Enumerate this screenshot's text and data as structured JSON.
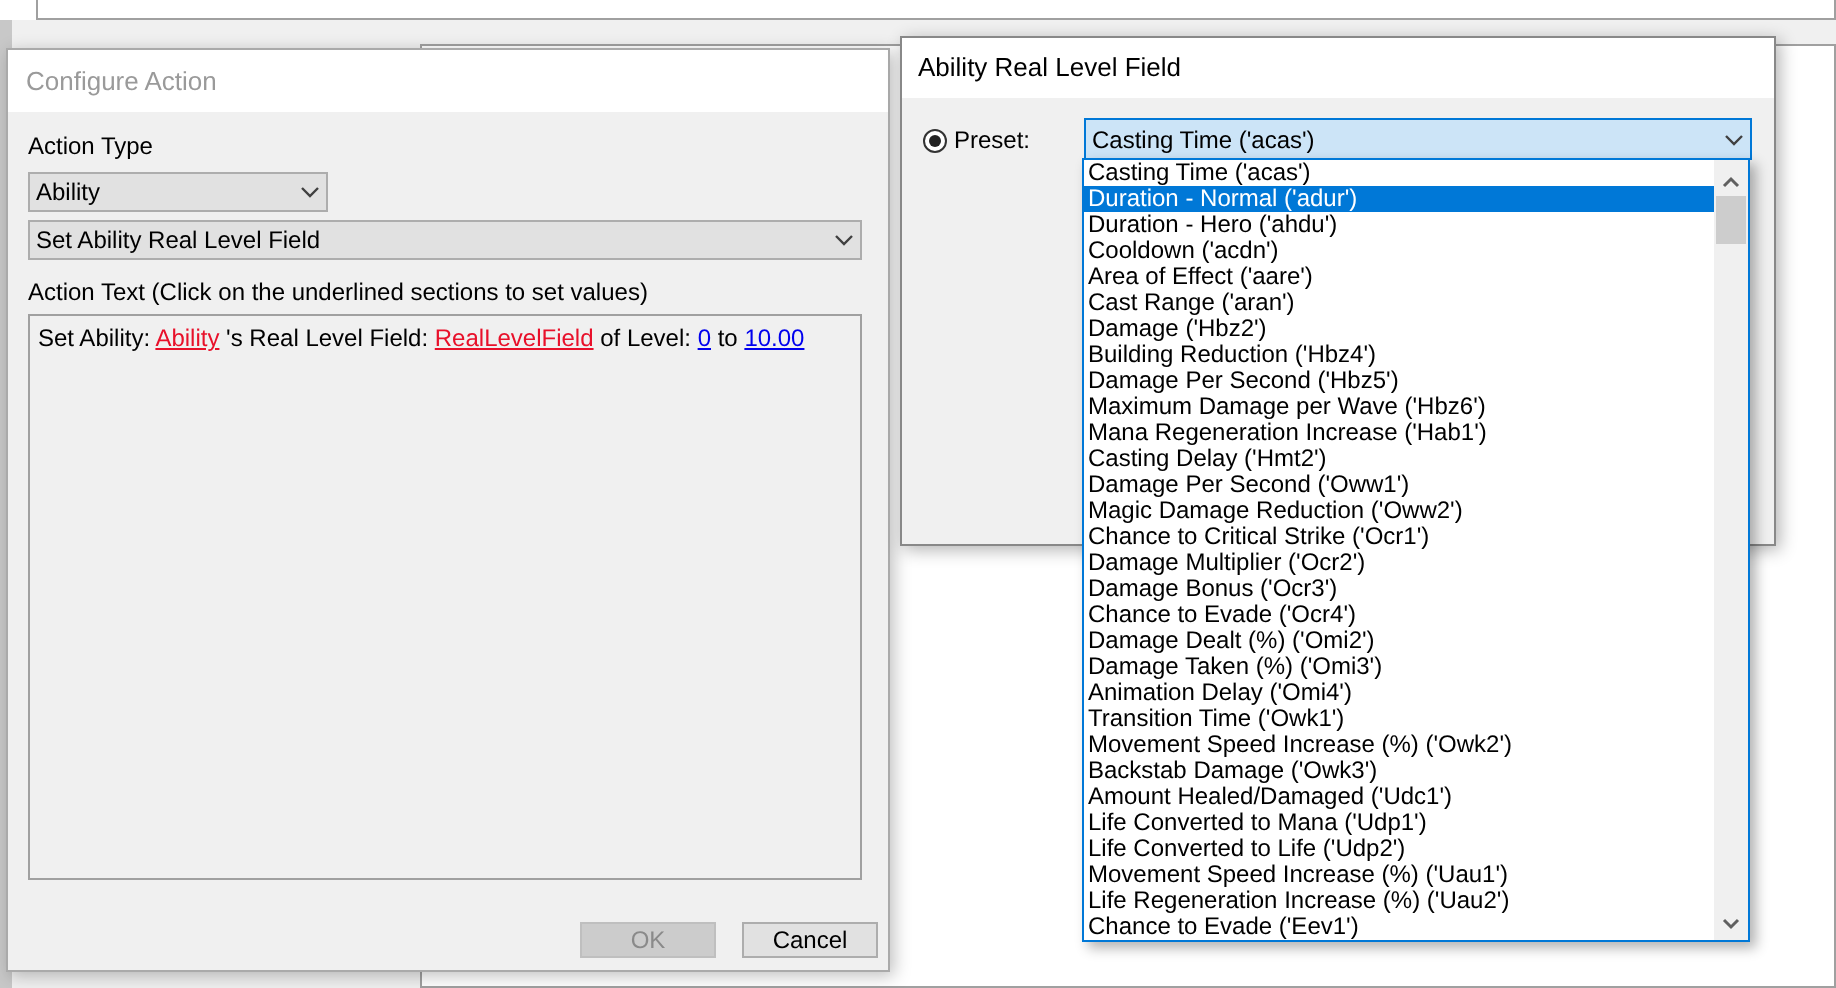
{
  "configure_action": {
    "title": "Configure Action",
    "active": false,
    "action_type_label": "Action Type",
    "category_combo": {
      "value": "Ability"
    },
    "action_combo": {
      "value": "Set Ability Real Level Field"
    },
    "action_text_label": "Action Text (Click on the underlined sections to set values)",
    "action_text": [
      {
        "kind": "plain",
        "text": "Set Ability: "
      },
      {
        "kind": "unset",
        "text": "Ability"
      },
      {
        "kind": "plain",
        "text": " 's Real Level Field: "
      },
      {
        "kind": "unset",
        "text": "RealLevelField"
      },
      {
        "kind": "plain",
        "text": " of Level: "
      },
      {
        "kind": "set",
        "text": "0"
      },
      {
        "kind": "plain",
        "text": " to "
      },
      {
        "kind": "set",
        "text": "10.00"
      }
    ],
    "buttons": [
      {
        "label": "OK",
        "disabled": true
      },
      {
        "label": "Cancel",
        "disabled": false
      }
    ]
  },
  "field_dialog": {
    "title": "Ability Real Level Field",
    "preset_radio": {
      "label": "Preset:",
      "checked": true
    },
    "preset_combo": {
      "value": "Casting Time ('acas')"
    },
    "options": [
      {
        "label": "Casting Time ('acas')",
        "selected": false
      },
      {
        "label": "Duration - Normal ('adur')",
        "selected": true
      },
      {
        "label": "Duration - Hero ('ahdu')",
        "selected": false
      },
      {
        "label": "Cooldown ('acdn')",
        "selected": false
      },
      {
        "label": "Area of Effect ('aare')",
        "selected": false
      },
      {
        "label": "Cast Range ('aran')",
        "selected": false
      },
      {
        "label": "Damage ('Hbz2')",
        "selected": false
      },
      {
        "label": "Building Reduction ('Hbz4')",
        "selected": false
      },
      {
        "label": "Damage Per Second ('Hbz5')",
        "selected": false
      },
      {
        "label": "Maximum Damage per Wave ('Hbz6')",
        "selected": false
      },
      {
        "label": "Mana Regeneration Increase ('Hab1')",
        "selected": false
      },
      {
        "label": "Casting Delay ('Hmt2')",
        "selected": false
      },
      {
        "label": "Damage Per Second ('Oww1')",
        "selected": false
      },
      {
        "label": "Magic Damage Reduction ('Oww2')",
        "selected": false
      },
      {
        "label": "Chance to Critical Strike ('Ocr1')",
        "selected": false
      },
      {
        "label": "Damage Multiplier ('Ocr2')",
        "selected": false
      },
      {
        "label": "Damage Bonus ('Ocr3')",
        "selected": false
      },
      {
        "label": "Chance to Evade ('Ocr4')",
        "selected": false
      },
      {
        "label": "Damage Dealt (%) ('Omi2')",
        "selected": false
      },
      {
        "label": "Damage Taken (%) ('Omi3')",
        "selected": false
      },
      {
        "label": "Animation Delay ('Omi4')",
        "selected": false
      },
      {
        "label": "Transition Time ('Owk1')",
        "selected": false
      },
      {
        "label": "Movement Speed Increase (%) ('Owk2')",
        "selected": false
      },
      {
        "label": "Backstab Damage ('Owk3')",
        "selected": false
      },
      {
        "label": "Amount Healed/Damaged ('Udc1')",
        "selected": false
      },
      {
        "label": "Life Converted to Mana ('Udp1')",
        "selected": false
      },
      {
        "label": "Life Converted to Life ('Udp2')",
        "selected": false
      },
      {
        "label": "Movement Speed Increase (%) ('Uau1')",
        "selected": false
      },
      {
        "label": "Life Regeneration Increase (%) ('Uau2')",
        "selected": false
      },
      {
        "label": "Chance to Evade ('Eev1')",
        "selected": false
      }
    ]
  }
}
